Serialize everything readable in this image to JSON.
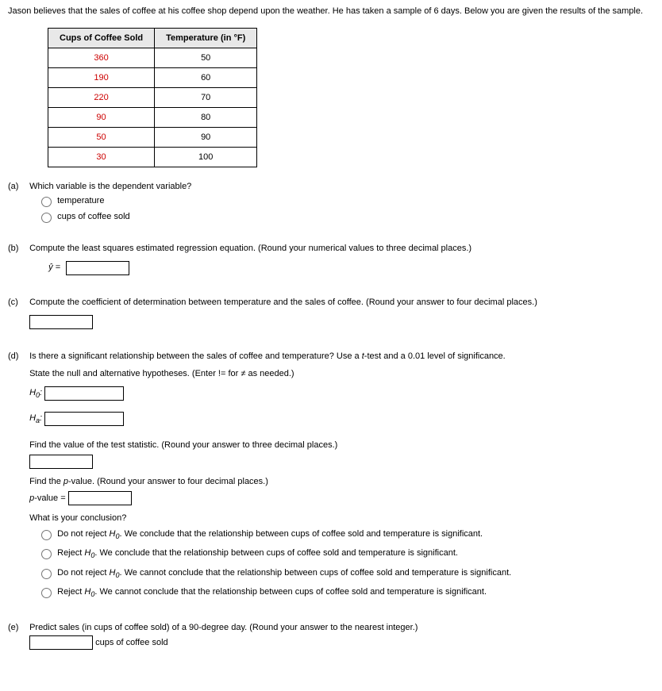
{
  "intro": "Jason believes that the sales of coffee at his coffee shop depend upon the weather. He has taken a sample of 6 days. Below you are given the results of the sample.",
  "table": {
    "headers": [
      "Cups of Coffee Sold",
      "Temperature (in °F)"
    ],
    "rows": [
      [
        "360",
        "50"
      ],
      [
        "190",
        "60"
      ],
      [
        "220",
        "70"
      ],
      [
        "90",
        "80"
      ],
      [
        "50",
        "90"
      ],
      [
        "30",
        "100"
      ]
    ]
  },
  "a": {
    "label": "(a)",
    "question": "Which variable is the dependent variable?",
    "opt1": "temperature",
    "opt2": "cups of coffee sold"
  },
  "b": {
    "label": "(b)",
    "question": "Compute the least squares estimated regression equation. (Round your numerical values to three decimal places.)",
    "yhat": "ŷ ="
  },
  "c": {
    "label": "(c)",
    "question": "Compute the coefficient of determination between temperature and the sales of coffee. (Round your answer to four decimal places.)"
  },
  "d": {
    "label": "(d)",
    "q1": "Is there a significant relationship between the sales of coffee and temperature? Use a t-test and a 0.01 level of significance.",
    "q2": "State the null and alternative hypotheses. (Enter != for ≠ as needed.)",
    "h0_label_pre": "H",
    "h0_sub": "0",
    "h0_colon": ":",
    "ha_label_pre": "H",
    "ha_sub": "a",
    "ha_colon": ":",
    "tstat": "Find the value of the test statistic. (Round your answer to three decimal places.)",
    "pval_q": "Find the p-value. (Round your answer to four decimal places.)",
    "pval_label": "p-value =",
    "conclusion_q": "What is your conclusion?",
    "c1_pre": "Do not reject ",
    "c1_post": ". We conclude that the relationship between cups of coffee sold and temperature is significant.",
    "c2_pre": "Reject ",
    "c2_post": ". We conclude that the relationship between cups of coffee sold and temperature is significant.",
    "c3_pre": "Do not reject ",
    "c3_post": ". We cannot conclude that the relationship between cups of coffee sold and temperature is significant.",
    "c4_pre": "Reject ",
    "c4_post": ". We cannot conclude that the relationship between cups of coffee sold and temperature is significant.",
    "H_part": "H",
    "H_sub": "0"
  },
  "e": {
    "label": "(e)",
    "question": "Predict sales (in cups of coffee sold) of a 90-degree day. (Round your answer to the nearest integer.)",
    "unit": "cups of coffee sold"
  }
}
